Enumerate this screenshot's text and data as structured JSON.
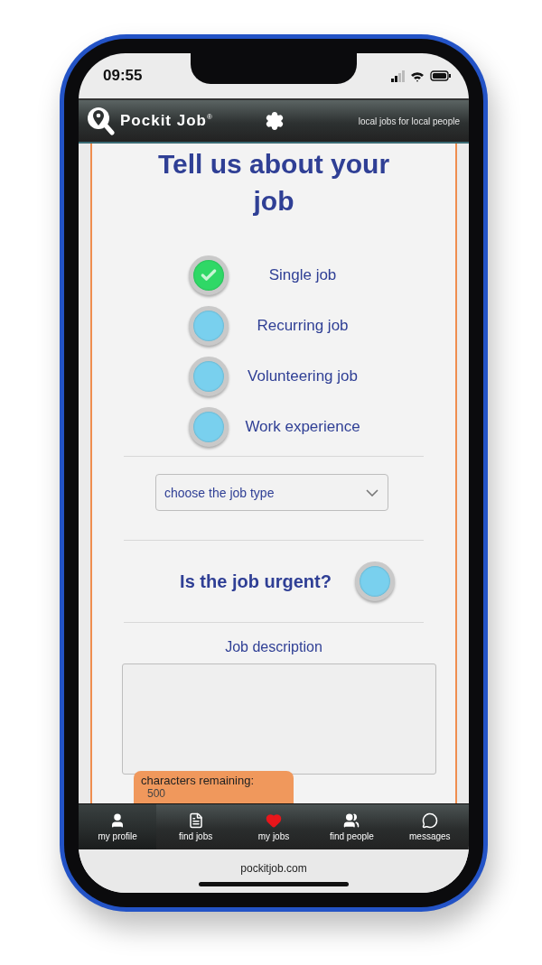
{
  "status_bar": {
    "time": "09:55"
  },
  "header": {
    "brand": "Pockit Job$^{®}$",
    "tagline": "local jobs for local people"
  },
  "form": {
    "title": "Tell us about your job",
    "job_options": [
      {
        "label": "Single job",
        "selected": true
      },
      {
        "label": "Recurring job",
        "selected": false
      },
      {
        "label": "Volunteering job",
        "selected": false
      },
      {
        "label": "Work experience",
        "selected": false
      }
    ],
    "job_type_select": {
      "placeholder": "choose the job type"
    },
    "urgent": {
      "label": "Is the job urgent?",
      "on": false
    },
    "description": {
      "label": "Job description"
    },
    "counter": {
      "label": "characters remaining:",
      "value": "500"
    }
  },
  "tab_bar": [
    {
      "kind": "profile",
      "label": "my profile",
      "selected": true
    },
    {
      "kind": "jobs",
      "label": "find jobs",
      "selected": false
    },
    {
      "kind": "heart",
      "label": "my jobs",
      "selected": false
    },
    {
      "kind": "people",
      "label": "find people",
      "selected": false
    },
    {
      "kind": "messages",
      "label": "messages",
      "selected": false
    }
  ],
  "footer": {
    "url": "pockitjob.com"
  }
}
